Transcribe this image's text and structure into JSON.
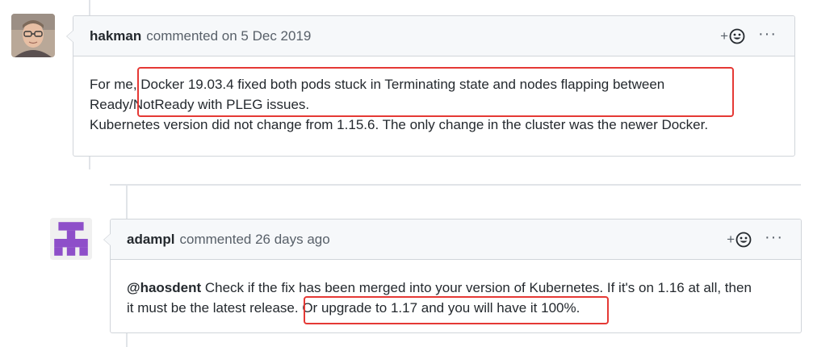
{
  "comments": [
    {
      "author": "hakman",
      "meta": "commented on 5 Dec 2019",
      "lines": [
        "For me, Docker 19.03.4 fixed both pods stuck in Terminating state and nodes flapping between",
        "Ready/NotReady with PLEG issues.",
        "Kubernetes version did not change from 1.15.6. The only change in the cluster was the newer Docker."
      ]
    },
    {
      "author": "adampl",
      "meta": "commented 26 days ago",
      "mention": "@haosdent",
      "lines": [
        "Check if the fix has been merged into your version of Kubernetes. If it's on 1.16 at all, then",
        "it must be the latest release. Or upgrade to 1.17 and you will have it 100%."
      ]
    }
  ],
  "actions": {
    "reaction_plus": "+",
    "reaction_icon": "smiley-icon",
    "more_label": "···"
  },
  "colors": {
    "highlight": "#e53935",
    "border": "#d1d5da",
    "header_bg": "#f6f8fa",
    "identicon": "#8e4fc9"
  }
}
